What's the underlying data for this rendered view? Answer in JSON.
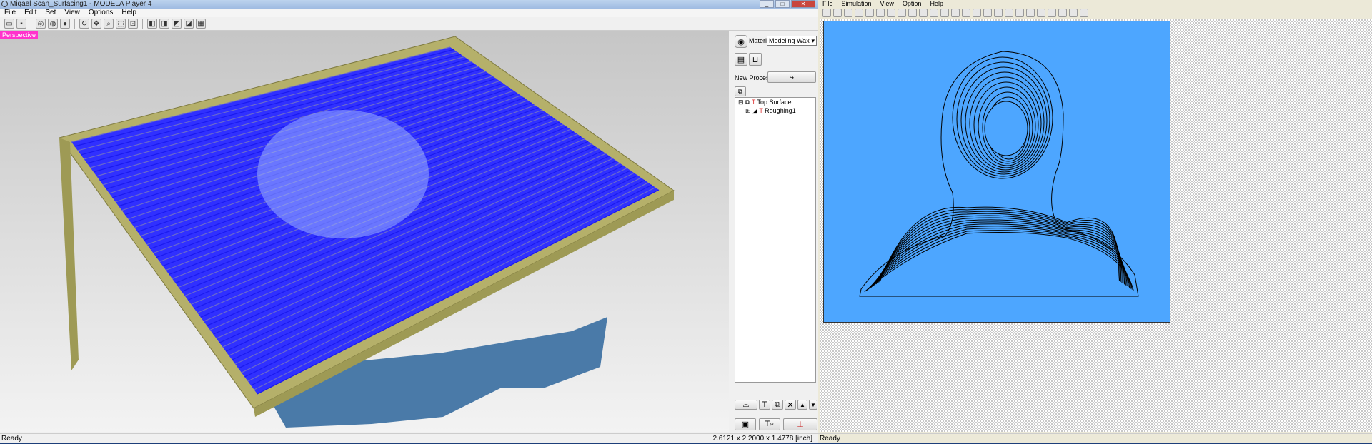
{
  "left_window": {
    "title": "Miqael Scan_Surfacing1 - MODELA Player 4",
    "menu": [
      "File",
      "Edit",
      "Set",
      "View",
      "Options",
      "Help"
    ],
    "toolbar_icons": [
      "open-icon",
      "save-icon",
      "view-wireframe-icon",
      "view-shaded-icon",
      "view-solid-icon",
      "rotate-icon",
      "pan-icon",
      "zoom-icon",
      "zoom-fit-icon",
      "zoom-window-icon",
      "view-top-icon",
      "view-front-icon",
      "view-right-icon",
      "view-iso-icon",
      "view-grid-icon"
    ],
    "viewport_label": "Perspective",
    "panel": {
      "material_label": "Material",
      "material_value": "Modeling Wax",
      "new_process_label": "New Process",
      "tree": [
        {
          "label": "Top Surface"
        },
        {
          "label": "Roughing1"
        }
      ]
    },
    "status": "Ready",
    "dimensions": "2.6121 x 2.2000 x 1.4778 [inch]",
    "colors": {
      "toolpath": "#0000ff",
      "stock": "#b5b06a",
      "shadow": "#4a7aa8"
    }
  },
  "right_window": {
    "menu": [
      "File",
      "Simulation",
      "View",
      "Option",
      "Help"
    ],
    "status": "Ready",
    "colors": {
      "canvas": "#4da6ff",
      "contour": "#000000"
    }
  }
}
